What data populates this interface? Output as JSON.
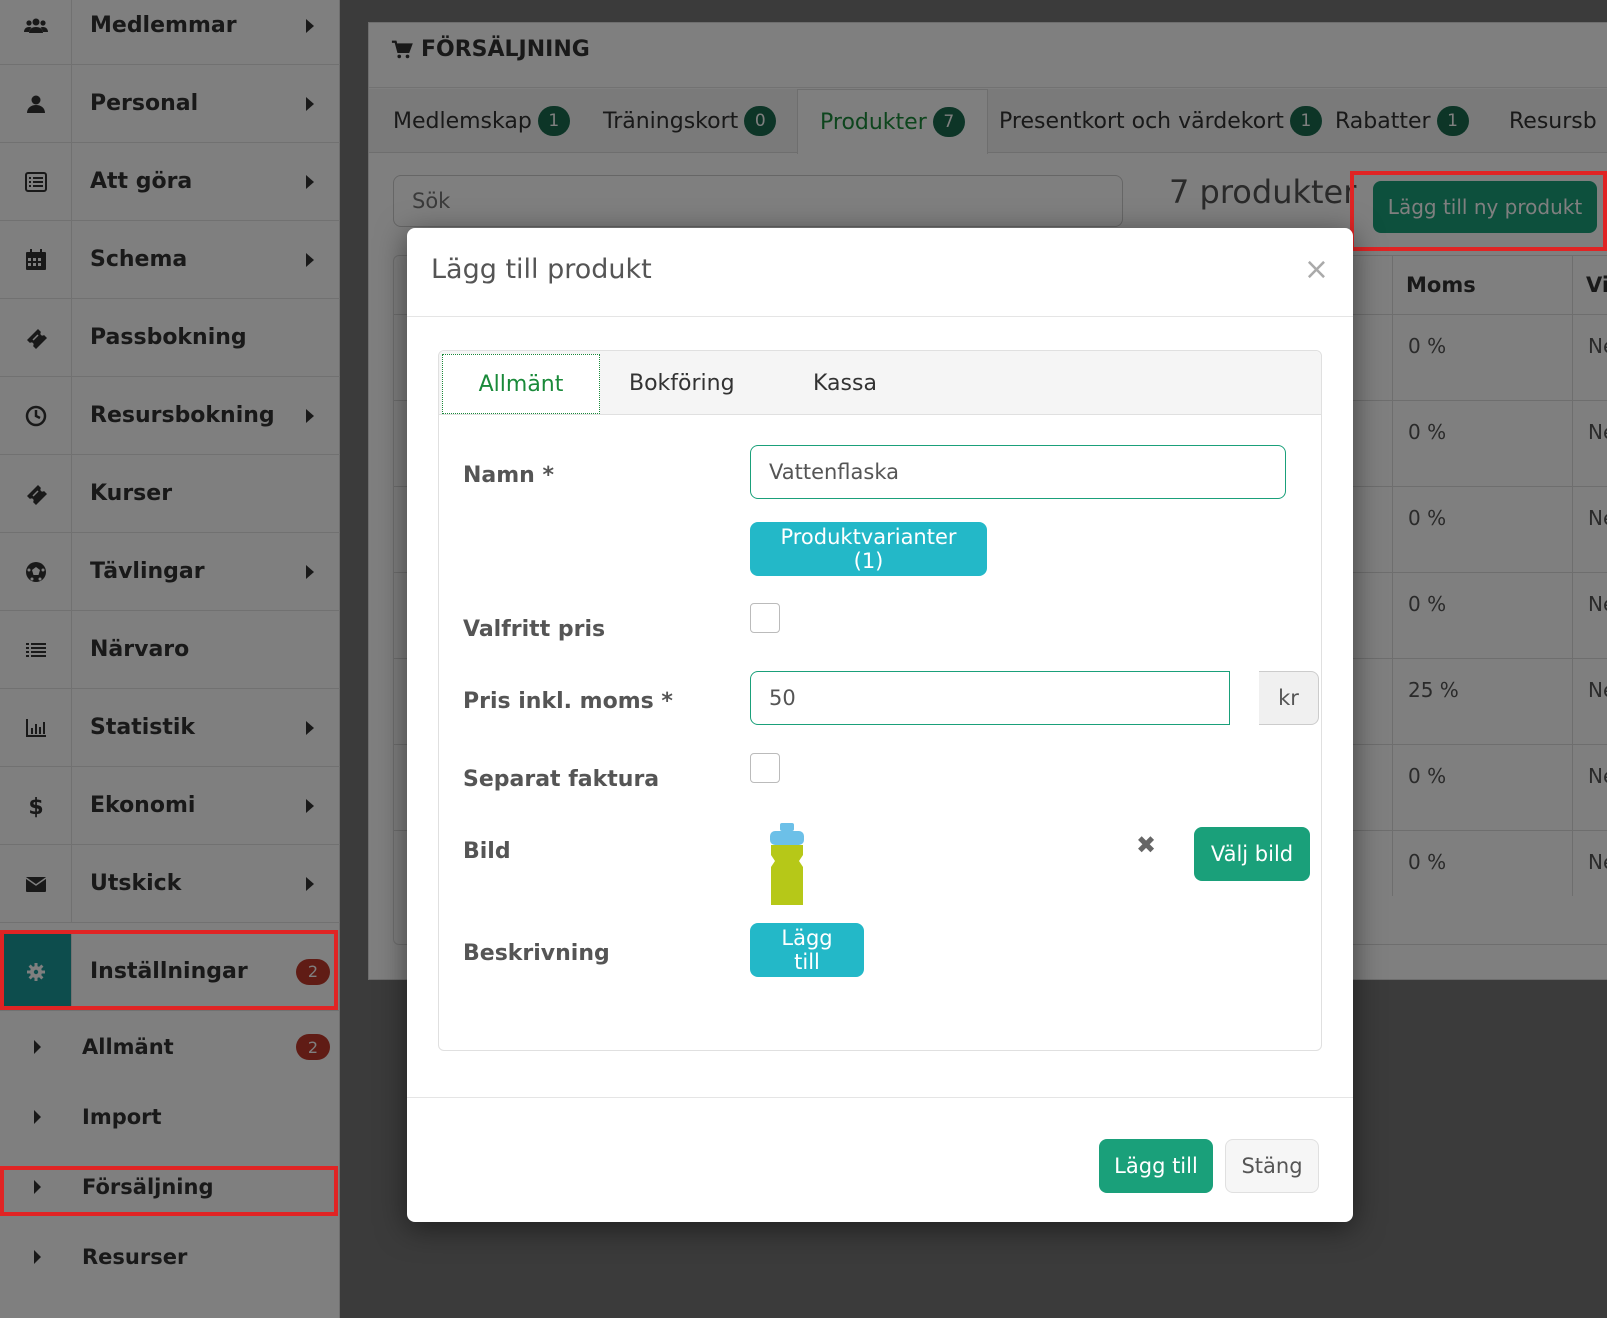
{
  "sidebar": {
    "items": [
      {
        "label": "Medlemmar"
      },
      {
        "label": "Personal"
      },
      {
        "label": "Att göra"
      },
      {
        "label": "Schema"
      },
      {
        "label": "Passbokning"
      },
      {
        "label": "Resursbokning"
      },
      {
        "label": "Kurser"
      },
      {
        "label": "Tävlingar"
      },
      {
        "label": "Närvaro"
      },
      {
        "label": "Statistik"
      },
      {
        "label": "Ekonomi"
      },
      {
        "label": "Utskick"
      },
      {
        "label": "Inställningar",
        "badge": "2"
      }
    ],
    "subitems": [
      {
        "label": "Allmänt",
        "badge": "2"
      },
      {
        "label": "Import"
      },
      {
        "label": "Försäljning"
      },
      {
        "label": "Resurser"
      }
    ]
  },
  "panel": {
    "title": "FÖRSÄLJNING",
    "tabs": [
      {
        "label": "Medlemskap",
        "count": "1"
      },
      {
        "label": "Träningskort",
        "count": "0"
      },
      {
        "label": "Produkter",
        "count": "7"
      },
      {
        "label": "Presentkort och värdekort",
        "count": "1"
      },
      {
        "label": "Rabatter",
        "count": "1"
      },
      {
        "label": "Resursb"
      }
    ],
    "search_placeholder": "Sök",
    "product_count": "7 produkter",
    "add_new_label": "Lägg till ny produkt",
    "table": {
      "headers": [
        "Moms",
        "Vis"
      ],
      "rows": [
        {
          "moms": "0 %",
          "vis": "Ne"
        },
        {
          "moms": "0 %",
          "vis": "Ne"
        },
        {
          "moms": "0 %",
          "vis": "Ne"
        },
        {
          "moms": "0 %",
          "vis": "Ne"
        },
        {
          "moms": "25 %",
          "vis": "Ne"
        },
        {
          "moms": "0 %",
          "vis": "Ne"
        },
        {
          "moms": "0 %",
          "vis": "Ne"
        }
      ]
    }
  },
  "modal": {
    "title": "Lägg till produkt",
    "close": "×",
    "tabs": [
      "Allmänt",
      "Bokföring",
      "Kassa"
    ],
    "fields": {
      "name_label": "Namn *",
      "name_value": "Vattenflaska",
      "variants_label": "Produktvarianter (1)",
      "optional_price_label": "Valfritt pris",
      "price_label": "Pris inkl. moms *",
      "price_value": "50",
      "price_unit": "kr",
      "separate_invoice_label": "Separat faktura",
      "image_label": "Bild",
      "image_remove": "✖",
      "choose_image_label": "Välj bild",
      "description_label": "Beskrivning",
      "description_add_label": "Lägg till"
    },
    "footer": {
      "add_label": "Lägg till",
      "close_label": "Stäng"
    }
  },
  "colors": {
    "accent_teal": "#1a9a9a",
    "success": "#1aa07a",
    "info": "#23b8c8",
    "badge_dark": "#1a6b4f",
    "badge_red": "#c0392b",
    "highlight_red": "#e02424"
  }
}
